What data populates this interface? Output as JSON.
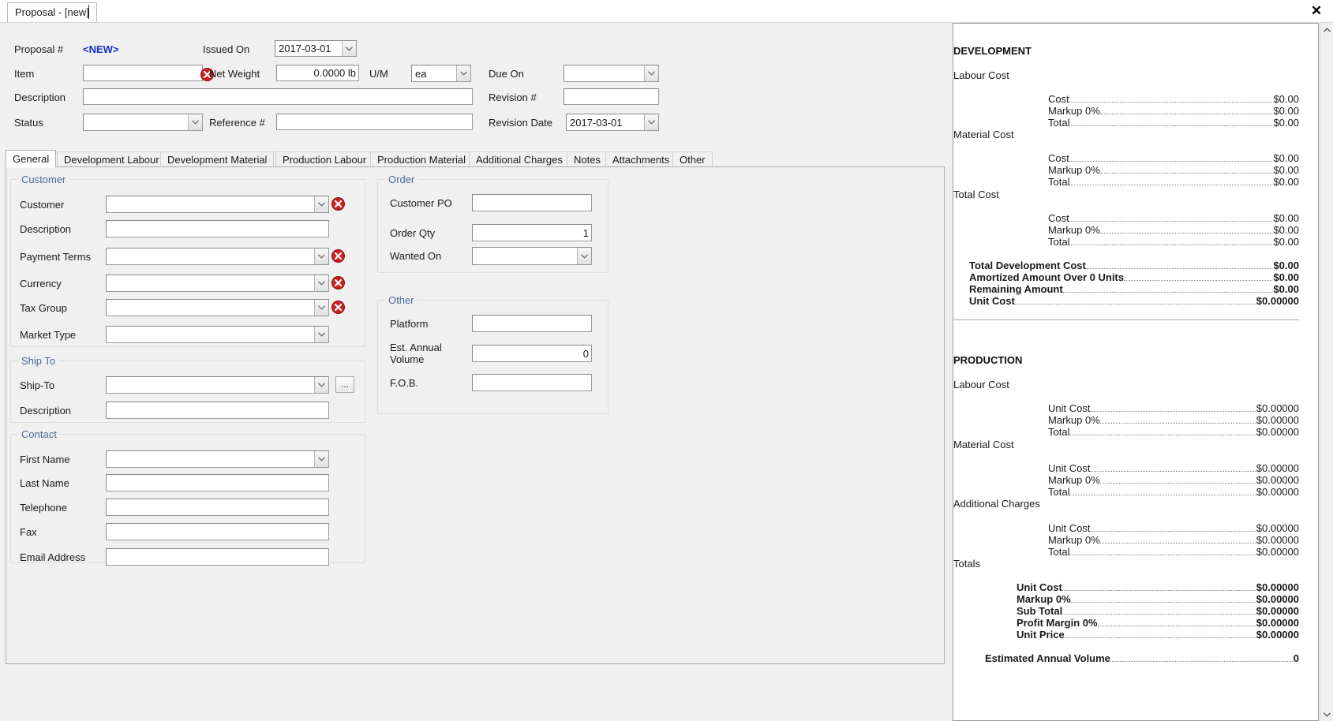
{
  "window": {
    "tab_label": "Proposal - [new]",
    "close_icon": "close-icon"
  },
  "header": {
    "proposal_number_label": "Proposal #",
    "proposal_number_value": "<NEW>",
    "issued_on_label": "Issued On",
    "issued_on_value": "2017-03-01",
    "item_label": "Item",
    "item_value": "",
    "net_weight_label": "Net Weight",
    "net_weight_value": "0.0000 lb",
    "um_label": "U/M",
    "um_value": "ea",
    "due_on_label": "Due On",
    "due_on_value": "",
    "description_label": "Description",
    "description_value": "",
    "revision_number_label": "Revision #",
    "revision_number_value": "",
    "status_label": "Status",
    "status_value": "",
    "reference_label": "Reference #",
    "reference_value": "",
    "revision_date_label": "Revision Date",
    "revision_date_value": "2017-03-01"
  },
  "tabs": [
    {
      "label": "General",
      "selected": true
    },
    {
      "label": "Development Labour",
      "selected": false
    },
    {
      "label": "Development Material",
      "selected": false
    },
    {
      "label": "Production Labour",
      "selected": false
    },
    {
      "label": "Production Material",
      "selected": false
    },
    {
      "label": "Additional Charges",
      "selected": false
    },
    {
      "label": "Notes",
      "selected": false
    },
    {
      "label": "Attachments",
      "selected": false
    },
    {
      "label": "Other",
      "selected": false
    }
  ],
  "customer_group": {
    "title": "Customer",
    "fields": {
      "customer_label": "Customer",
      "customer_value": "",
      "description_label": "Description",
      "description_value": "",
      "payment_terms_label": "Payment Terms",
      "payment_terms_value": "",
      "currency_label": "Currency",
      "currency_value": "",
      "tax_group_label": "Tax Group",
      "tax_group_value": "",
      "market_type_label": "Market Type",
      "market_type_value": ""
    }
  },
  "ship_to_group": {
    "title": "Ship To",
    "fields": {
      "ship_to_label": "Ship-To",
      "ship_to_value": "",
      "browse_button_label": "...",
      "description_label": "Description",
      "description_value": ""
    }
  },
  "contact_group": {
    "title": "Contact",
    "fields": {
      "first_name_label": "First Name",
      "first_name_value": "",
      "last_name_label": "Last Name",
      "last_name_value": "",
      "telephone_label": "Telephone",
      "telephone_value": "",
      "fax_label": "Fax",
      "fax_value": "",
      "email_label": "Email Address",
      "email_value": ""
    }
  },
  "order_group": {
    "title": "Order",
    "fields": {
      "customer_po_label": "Customer PO",
      "customer_po_value": "",
      "order_qty_label": "Order Qty",
      "order_qty_value": "1",
      "wanted_on_label": "Wanted On",
      "wanted_on_value": ""
    }
  },
  "other_group": {
    "title": "Other",
    "fields": {
      "platform_label": "Platform",
      "platform_value": "",
      "est_annual_volume_label": "Est. Annual Volume",
      "est_annual_volume_label_line1": "Est. Annual",
      "est_annual_volume_label_line2": "Volume",
      "est_annual_volume_value": "0",
      "fob_label": "F.O.B.",
      "fob_value": ""
    }
  },
  "summary": {
    "development": {
      "heading": "DEVELOPMENT",
      "groups": [
        {
          "label": "Labour Cost",
          "rows": [
            {
              "name": "Cost",
              "value": "$0.00"
            },
            {
              "name": "Markup 0%",
              "value": "$0.00"
            },
            {
              "name": "Total",
              "value": "$0.00"
            }
          ]
        },
        {
          "label": "Material Cost",
          "rows": [
            {
              "name": "Cost",
              "value": "$0.00"
            },
            {
              "name": "Markup 0%",
              "value": "$0.00"
            },
            {
              "name": "Total",
              "value": "$0.00"
            }
          ]
        },
        {
          "label": "Total Cost",
          "rows": [
            {
              "name": "Cost",
              "value": "$0.00"
            },
            {
              "name": "Markup 0%",
              "value": "$0.00"
            },
            {
              "name": "Total",
              "value": "$0.00"
            }
          ]
        }
      ],
      "totals": [
        {
          "name": "Total Development Cost",
          "value": "$0.00"
        },
        {
          "name": "Amortized Amount Over 0 Units",
          "value": "$0.00"
        },
        {
          "name": "Remaining Amount",
          "value": "$0.00"
        },
        {
          "name": "Unit Cost",
          "value": "$0.00000"
        }
      ]
    },
    "production": {
      "heading": "PRODUCTION",
      "groups": [
        {
          "label": "Labour Cost",
          "rows": [
            {
              "name": "Unit Cost",
              "value": "$0.00000"
            },
            {
              "name": "Markup 0%",
              "value": "$0.00000"
            },
            {
              "name": "Total",
              "value": "$0.00000"
            }
          ]
        },
        {
          "label": "Material Cost",
          "rows": [
            {
              "name": "Unit Cost",
              "value": "$0.00000"
            },
            {
              "name": "Markup 0%",
              "value": "$0.00000"
            },
            {
              "name": "Total",
              "value": "$0.00000"
            }
          ]
        },
        {
          "label": "Additional Charges",
          "rows": [
            {
              "name": "Unit Cost",
              "value": "$0.00000"
            },
            {
              "name": "Markup 0%",
              "value": "$0.00000"
            },
            {
              "name": "Total",
              "value": "$0.00000"
            }
          ]
        },
        {
          "label": "Totals",
          "rows": [
            {
              "name": "Unit Cost",
              "value": "$0.00000"
            },
            {
              "name": "Markup 0%",
              "value": "$0.00000"
            },
            {
              "name": "Sub Total",
              "value": "$0.00000"
            },
            {
              "name": "Profit Margin 0%",
              "value": "$0.00000"
            },
            {
              "name": "Unit Price",
              "value": "$0.00000"
            }
          ]
        }
      ],
      "footer": [
        {
          "name": "Estimated Annual Volume",
          "value": "0"
        }
      ]
    }
  },
  "colors": {
    "accent_link": "#1432c8",
    "group_title": "#4a6a9a",
    "error_red": "#cc1f1f",
    "window_bg": "#f0f0f0"
  }
}
